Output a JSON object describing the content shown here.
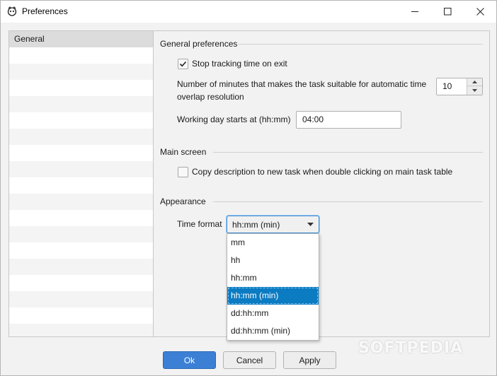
{
  "window": {
    "title": "Preferences"
  },
  "sidebar": {
    "items": [
      {
        "label": "General",
        "selected": true
      }
    ]
  },
  "general": {
    "section_title": "General preferences",
    "stop_tracking": {
      "label": "Stop tracking time on exit",
      "checked": true
    },
    "overlap_label": "Number of minutes that makes the task suitable for automatic time overlap resolution",
    "overlap_value": "10",
    "working_day_label": "Working day starts at (hh:mm)",
    "working_day_value": "04:00"
  },
  "main_screen": {
    "section_title": "Main screen",
    "copy_description": {
      "label": "Copy description to new task when double clicking on main task table",
      "checked": false
    }
  },
  "appearance": {
    "section_title": "Appearance",
    "time_format_label": "Time format",
    "time_format_value": "hh:mm (min)",
    "options": [
      "mm",
      "hh",
      "hh:mm",
      "hh:mm (min)",
      "dd:hh:mm",
      "dd:hh:mm (min)"
    ],
    "selected_index": 3
  },
  "buttons": {
    "ok": "Ok",
    "cancel": "Cancel",
    "apply": "Apply"
  },
  "watermark": "SOFTPEDIA",
  "colors": {
    "accent": "#3c80d6",
    "selection": "#0b7bc2"
  }
}
